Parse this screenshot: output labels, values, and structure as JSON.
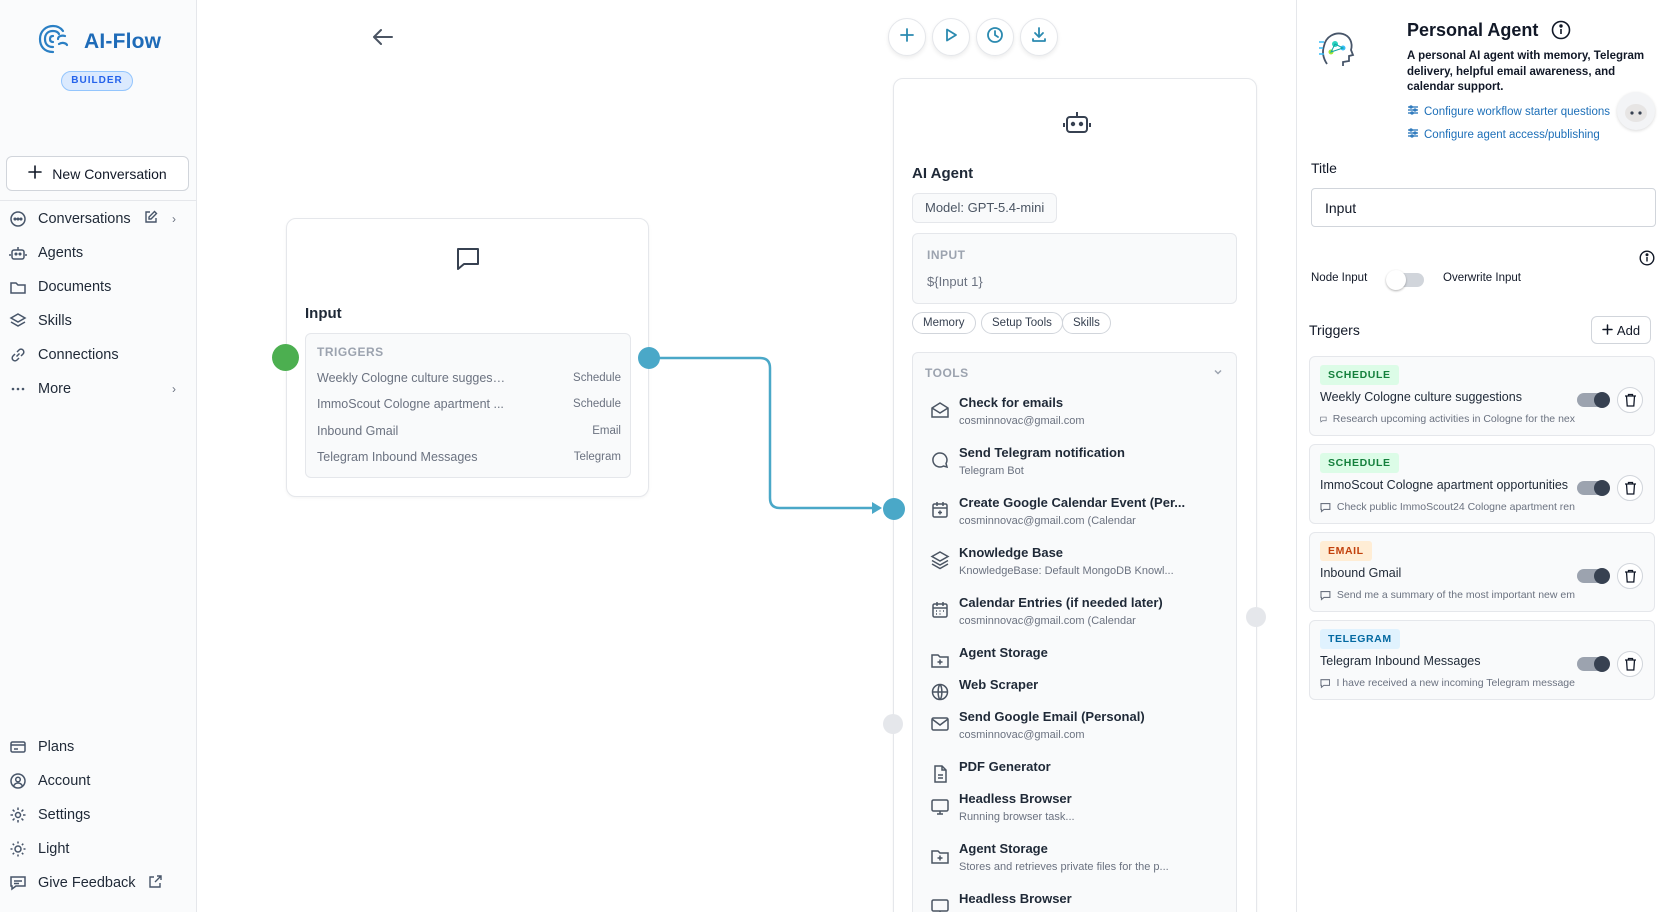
{
  "app": {
    "name": "AI-Flow",
    "badge": "BUILDER"
  },
  "sidebar": {
    "new_conversation": "New Conversation",
    "items": [
      {
        "label": "Conversations",
        "icon": "chat-icon"
      },
      {
        "label": "Agents",
        "icon": "robot-icon"
      },
      {
        "label": "Documents",
        "icon": "folder-icon"
      },
      {
        "label": "Skills",
        "icon": "layers-icon"
      },
      {
        "label": "Connections",
        "icon": "link-icon"
      },
      {
        "label": "More",
        "icon": "ellipsis-icon"
      }
    ],
    "bottom_items": [
      {
        "label": "Plans",
        "icon": "card-icon"
      },
      {
        "label": "Account",
        "icon": "user-icon"
      },
      {
        "label": "Settings",
        "icon": "gear-icon"
      },
      {
        "label": "Light",
        "icon": "sun-icon"
      },
      {
        "label": "Give Feedback",
        "icon": "feedback-icon"
      }
    ]
  },
  "input_node": {
    "title": "Input",
    "triggers_header": "TRIGGERS",
    "triggers": [
      {
        "name": "Weekly Cologne culture suggesti...",
        "type": "Schedule"
      },
      {
        "name": "ImmoScout Cologne apartment ...",
        "type": "Schedule"
      },
      {
        "name": "Inbound Gmail",
        "type": "Email"
      },
      {
        "name": "Telegram Inbound Messages",
        "type": "Telegram"
      }
    ]
  },
  "agent_node": {
    "title": "AI Agent",
    "model": "Model: GPT-5.4-mini",
    "input_label": "INPUT",
    "input_value": "${Input 1}",
    "pills": [
      "Memory",
      "Setup Tools",
      "Skills"
    ],
    "tools_header": "TOOLS",
    "tools": [
      {
        "name": "Check for emails",
        "sub": "cosminnovac@gmail.com",
        "icon": "envelope-open-icon"
      },
      {
        "name": "Send Telegram notification",
        "sub": "Telegram Bot",
        "icon": "chat-bubble-icon"
      },
      {
        "name": "Create Google Calendar Event (Per...",
        "sub": "cosminnovac@gmail.com (Calendar",
        "icon": "calendar-plus-icon"
      },
      {
        "name": "Knowledge Base",
        "sub": "KnowledgeBase: Default MongoDB Knowl...",
        "icon": "layers-icon"
      },
      {
        "name": "Calendar Entries (if needed later)",
        "sub": "cosminnovac@gmail.com (Calendar",
        "icon": "calendar-icon"
      },
      {
        "name": "Agent Storage",
        "sub": "",
        "icon": "folder-plus-icon"
      },
      {
        "name": "Web Scraper",
        "sub": "",
        "icon": "globe-icon"
      },
      {
        "name": "Send Google Email (Personal)",
        "sub": "cosminnovac@gmail.com",
        "icon": "envelope-icon"
      },
      {
        "name": "PDF Generator",
        "sub": "",
        "icon": "document-icon"
      },
      {
        "name": "Headless Browser",
        "sub": "Running browser task...",
        "icon": "monitor-icon"
      },
      {
        "name": "Agent Storage",
        "sub": "Stores and retrieves private files for the p...",
        "icon": "folder-plus-icon"
      },
      {
        "name": "Headless Browser",
        "sub": "",
        "icon": "monitor-icon"
      }
    ]
  },
  "panel": {
    "agent_title": "Personal Agent",
    "agent_description": "A personal AI agent with memory, Telegram delivery, helpful email awareness, and calendar support.",
    "link_starter": "Configure workflow starter questions",
    "link_access": "Configure agent access/publishing",
    "title_label": "Title",
    "title_value": "Input",
    "node_input_label": "Node Input",
    "overwrite_label": "Overwrite Input",
    "triggers_label": "Triggers",
    "add_label": "Add",
    "triggers": [
      {
        "badge": "SCHEDULE",
        "name": "Weekly Cologne culture suggestions",
        "desc": "Research upcoming activities in Cologne for the nex",
        "badge_bg": "#dcfce7",
        "badge_fg": "#15803d"
      },
      {
        "badge": "SCHEDULE",
        "name": "ImmoScout Cologne apartment opportunities",
        "desc": "Check public ImmoScout24 Cologne apartment ren",
        "badge_bg": "#dcfce7",
        "badge_fg": "#15803d"
      },
      {
        "badge": "EMAIL",
        "name": "Inbound Gmail",
        "desc": "Send me a summary of the most important new em",
        "badge_bg": "#ffedd5",
        "badge_fg": "#c2410c"
      },
      {
        "badge": "TELEGRAM",
        "name": "Telegram Inbound Messages",
        "desc": "I have received a new incoming Telegram message",
        "badge_bg": "#e0f2fe",
        "badge_fg": "#0369a1"
      }
    ]
  },
  "colors": {
    "brand": "#1e6bb8",
    "edge": "#4aa8c8",
    "start_dot": "#4caf50"
  }
}
